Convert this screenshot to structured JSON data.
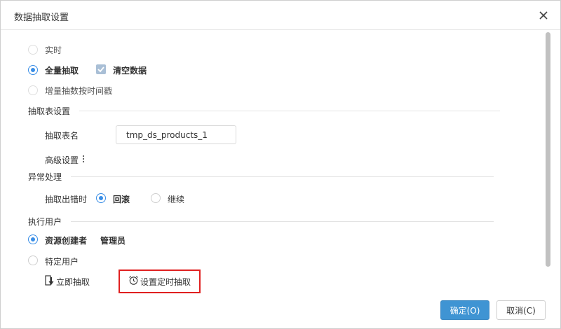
{
  "dialog": {
    "title": "数据抽取设置",
    "close_icon": "close-icon"
  },
  "extract_mode": {
    "options": [
      {
        "label": "实时",
        "checked": false,
        "disabled": true
      },
      {
        "label": "全量抽取",
        "checked": true,
        "disabled": false
      },
      {
        "label": "增量抽数按时间戳",
        "checked": false,
        "disabled": true
      }
    ],
    "clear_data": {
      "label": "清空数据",
      "checked": true
    }
  },
  "table_settings": {
    "section_title": "抽取表设置",
    "table_name_label": "抽取表名",
    "table_name_value": "tmp_ds_products_1",
    "advanced_label": "高级设置",
    "advanced_icon": "more-vertical-icon"
  },
  "error_handling": {
    "section_title": "异常处理",
    "on_error_label": "抽取出错时",
    "options": [
      {
        "label": "回滚",
        "checked": true
      },
      {
        "label": "继续",
        "checked": false
      }
    ]
  },
  "exec_user": {
    "section_title": "执行用户",
    "options": [
      {
        "label": "资源创建者",
        "checked": true,
        "value": "管理员"
      },
      {
        "label": "特定用户",
        "checked": false
      }
    ]
  },
  "actions": {
    "extract_now": {
      "label": "立即抽取",
      "icon": "download-icon"
    },
    "schedule": {
      "label": "设置定时抽取",
      "icon": "alarm-clock-icon"
    }
  },
  "footer": {
    "confirm_label": "确定(O)",
    "cancel_label": "取消(C)"
  },
  "colors": {
    "accent": "#3a8ee6",
    "primary_button": "#3f94d3",
    "highlight": "#e02020"
  }
}
